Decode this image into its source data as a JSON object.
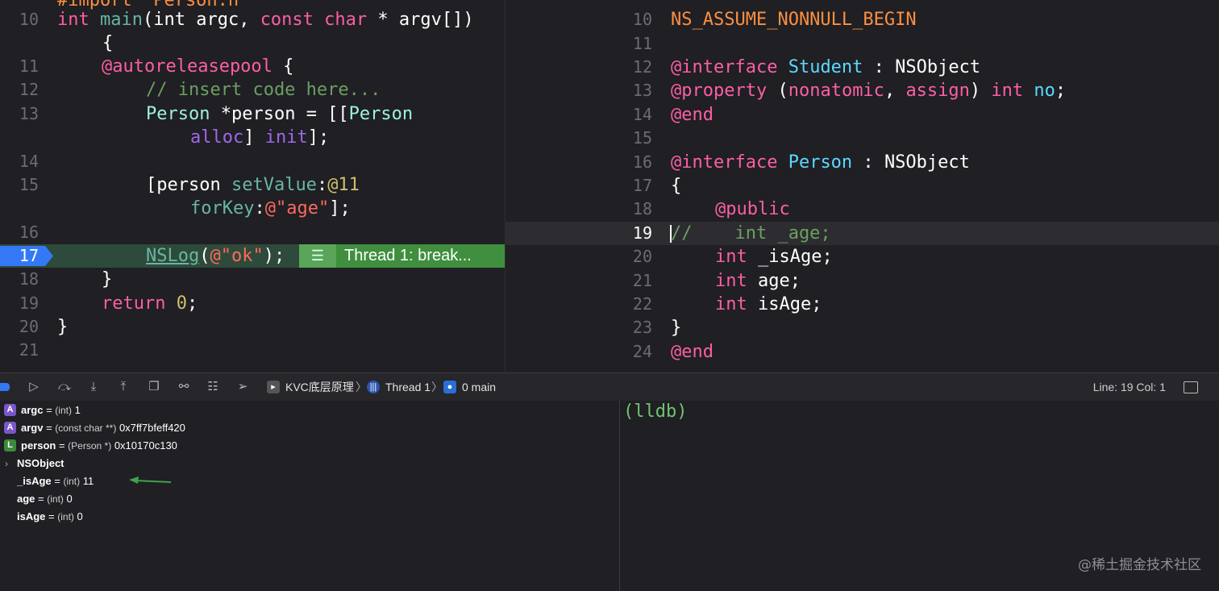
{
  "left_editor": {
    "partial_top": "#import \"Person.h\"",
    "lines": [
      {
        "n": "10",
        "t": "main_sig"
      },
      {
        "n": "",
        "t": "brace"
      },
      {
        "n": "11",
        "t": "pool"
      },
      {
        "n": "12",
        "t": "comment"
      },
      {
        "n": "13",
        "t": "alloc1"
      },
      {
        "n": "",
        "t": "alloc2"
      },
      {
        "n": "14",
        "t": "blank"
      },
      {
        "n": "15",
        "t": "set1"
      },
      {
        "n": "",
        "t": "set2"
      },
      {
        "n": "16",
        "t": "blank"
      },
      {
        "n": "17",
        "t": "nslog"
      },
      {
        "n": "18",
        "t": "close"
      },
      {
        "n": "19",
        "t": "ret"
      },
      {
        "n": "20",
        "t": "close2"
      },
      {
        "n": "21",
        "t": "blank"
      }
    ],
    "tokens": {
      "int": "int",
      "main": "main",
      "argc_decl": "(int argc, ",
      "const_kw": "const",
      "char_kw": " char",
      "argv_rest": " * argv[])",
      "brace": "{",
      "pool": "@autoreleasepool",
      "pool_brace": " {",
      "comment": "// insert code here...",
      "person_type": "Person",
      "alloc1_rest": " *person = [[",
      "person_cls": "Person",
      "alloc_kw": "alloc",
      "init_kw": "init",
      "alloc2_rest": "];",
      "set_open": "[person ",
      "setValue": "setValue",
      "colon_at": ":",
      "num11": "@11",
      "forKey": "forKey",
      "age_str": "@\"age\"",
      "set_close": "];",
      "nslog": "NSLog",
      "ok_str": "@\"ok\"",
      "nslog_rest": ");",
      "close": "}",
      "return_kw": "return",
      "zero": "0",
      "semi": ";"
    },
    "breakpoint_line": "17",
    "thread_badge": "Thread 1: break..."
  },
  "right_editor": {
    "line_numbers": [
      "10",
      "11",
      "12",
      "13",
      "14",
      "15",
      "16",
      "17",
      "18",
      "19",
      "20",
      "21",
      "22",
      "23",
      "24"
    ],
    "tokens": {
      "ns_begin": "NS_ASSUME_NONNULL_BEGIN",
      "interface_kw": "@interface",
      "student": "Student",
      "colon": " : ",
      "nsobject": "NSObject",
      "property_kw": "@property",
      "paren_open": " (",
      "nonatomic": "nonatomic",
      "comma": ", ",
      "assign": "assign",
      "paren_close": ") ",
      "int": "int",
      "no": "no",
      "semi": ";",
      "end_kw": "@end",
      "person": "Person",
      "lbrace": "{",
      "public_kw": "@public",
      "commented_age": "//    int _age;",
      "isAge_u": " _isAge;",
      "age": " age;",
      "isAge": " isAge;",
      "rbrace": "}"
    }
  },
  "debug_bar": {
    "project": "KVC底层原理",
    "thread": "Thread 1",
    "frame": "0 main",
    "line_col": "Line: 19  Col: 1"
  },
  "variables": [
    {
      "badge": "A",
      "name": "argc",
      "type": "(int)",
      "value": "1"
    },
    {
      "badge": "A",
      "name": "argv",
      "type": "(const char **)",
      "value": "0x7ff7bfeff420"
    },
    {
      "badge": "L",
      "name": "person",
      "type": "(Person *)",
      "value": "0x10170c130"
    },
    {
      "badge": "",
      "name": "NSObject",
      "type": "",
      "value": ""
    },
    {
      "badge": "",
      "name": "_isAge",
      "type": "(int)",
      "value": "11"
    },
    {
      "badge": "",
      "name": "age",
      "type": "(int)",
      "value": "0"
    },
    {
      "badge": "",
      "name": "isAge",
      "type": "(int)",
      "value": "0"
    }
  ],
  "console": {
    "prompt": "(lldb)"
  },
  "watermark": "@稀土掘金技术社区",
  "colors": {
    "breakpoint": "#3478f6",
    "thread_badge": "#3f8f3f",
    "arrow": "#3fa34d"
  }
}
